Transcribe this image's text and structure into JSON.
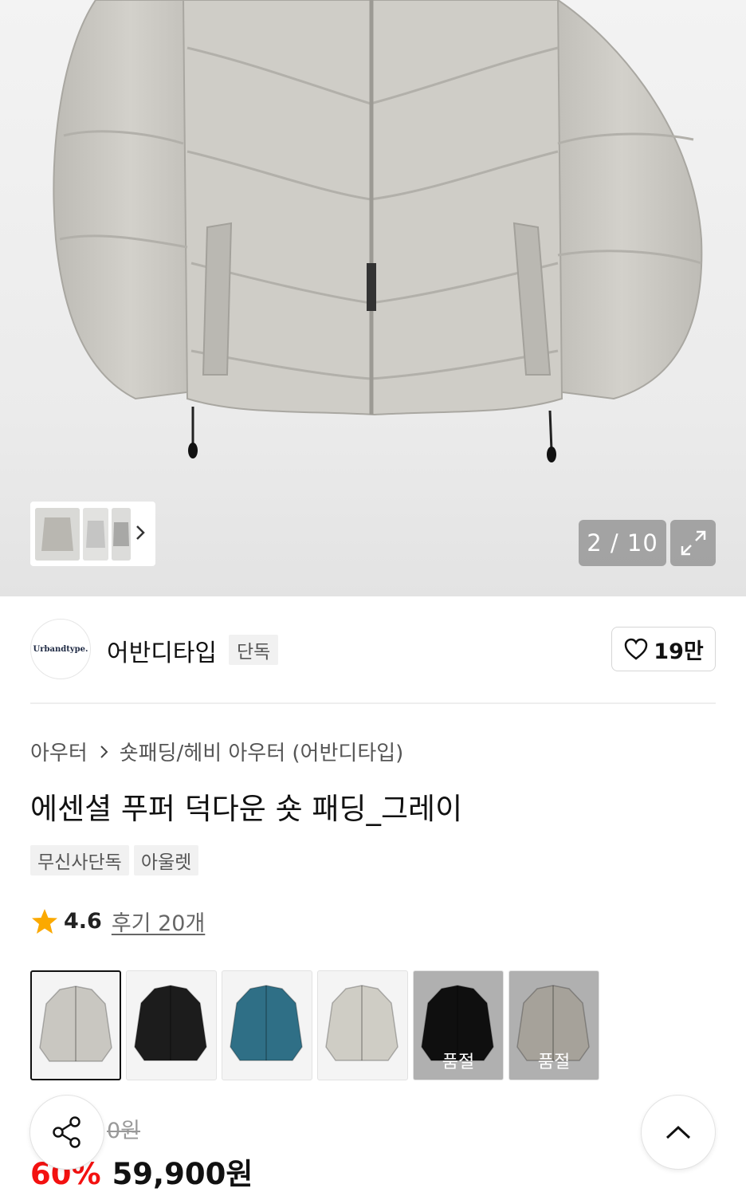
{
  "gallery": {
    "counter": "2 / 10",
    "expand_icon": "expand-icon",
    "thumb_next_icon": "chevron-right-icon"
  },
  "brand": {
    "logo_text": "Urbandtype.",
    "name": "어반디타입",
    "badge": "단독",
    "like_icon": "heart-icon",
    "like_count": "19만"
  },
  "breadcrumb": {
    "category": "아우터",
    "subcategory": "숏패딩/헤비 아우터 (어반디타입)"
  },
  "product": {
    "title": "에센셜 푸퍼 덕다운 숏 패딩_그레이",
    "tags": [
      "무신사단독",
      "아울렛"
    ],
    "rating": "4.6",
    "reviews": "후기 20개"
  },
  "options": [
    {
      "color": "#c9c7c1",
      "selected": true,
      "soldout": false,
      "sold_label": ""
    },
    {
      "color": "#1c1c1c",
      "selected": false,
      "soldout": false,
      "sold_label": ""
    },
    {
      "color": "#2f6f86",
      "selected": false,
      "soldout": false,
      "sold_label": ""
    },
    {
      "color": "#cfcdc5",
      "selected": false,
      "soldout": false,
      "sold_label": ""
    },
    {
      "color": "#151515",
      "selected": false,
      "soldout": true,
      "sold_label": "품절"
    },
    {
      "color": "#e7e1d6",
      "selected": false,
      "soldout": true,
      "sold_label": "품절"
    }
  ],
  "price": {
    "original": "0원",
    "discount": "60%",
    "final": "59,900원"
  },
  "colors": {
    "discount_red": "#f31110",
    "jacket_gray": "#c9c7c1"
  },
  "floating": {
    "share_icon": "share-icon",
    "top_icon": "chevron-up-icon"
  }
}
